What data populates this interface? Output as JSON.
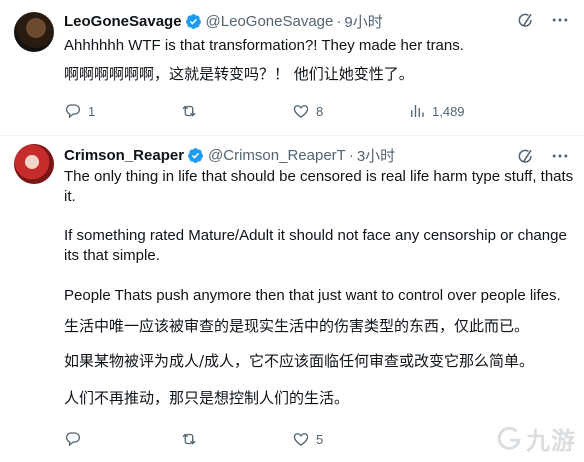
{
  "tweet1": {
    "display_name": "LeoGoneSavage",
    "handle": "@LeoGoneSavage",
    "separator": "·",
    "time": "9小时",
    "text_en": "Ahhhhhh WTF is that transformation?! They made her trans.",
    "text_cn": "啊啊啊啊啊啊，这就是转变吗？！ 他们让她变性了。",
    "replies": "1",
    "retweets": "",
    "likes": "8",
    "views": "1,489"
  },
  "tweet2": {
    "display_name": "Crimson_Reaper",
    "handle": "@Crimson_ReaperT",
    "separator": "·",
    "time": "3小时",
    "paragraph1": "The only thing in life that should be censored is real life harm type stuff, thats it.",
    "paragraph2": "If something rated Mature/Adult it should not face any censorship or change its that simple.",
    "paragraph3": "People Thats push anymore then that just want to control over people lifes.",
    "cn1": "生活中唯一应该被审查的是现实生活中的伤害类型的东西，仅此而已。",
    "cn2": "如果某物被评为成人/成人，它不应该面临任何审查或改变它那么简单。",
    "cn3": "人们不再推动，那只是想控制人们的生活。",
    "replies": "",
    "retweets": "",
    "likes": "5"
  },
  "watermark": "九游",
  "colors": {
    "verified": "#1d9bf0",
    "muted": "#536471",
    "text": "#0f1419"
  }
}
